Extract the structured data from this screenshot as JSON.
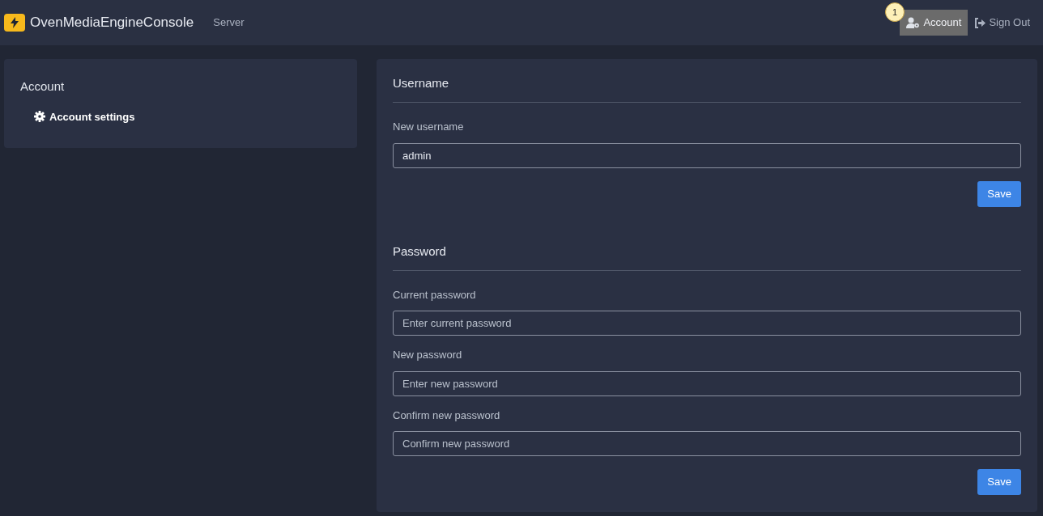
{
  "header": {
    "brand": "OvenMediaEngineConsole",
    "nav": [
      {
        "label": "Server"
      }
    ],
    "marker": "1",
    "user_nav": [
      {
        "kind": "account",
        "label": "Account",
        "selected": true
      },
      {
        "kind": "signout",
        "label": "Sign Out",
        "selected": false
      }
    ]
  },
  "sidebar": {
    "title": "Account",
    "items": [
      {
        "label": "Account settings",
        "selected": true
      }
    ]
  },
  "sections": [
    {
      "title": "Username",
      "fields": [
        {
          "label": "New username",
          "value": "admin"
        }
      ],
      "button": "Save"
    },
    {
      "title": "Password",
      "fields": [
        {
          "label": "Current password",
          "placeholder": "Enter current password"
        },
        {
          "label": "New password",
          "placeholder": "Enter new password"
        },
        {
          "label": "Confirm new password",
          "placeholder": "Confirm new password"
        }
      ],
      "button": "Save"
    }
  ]
}
